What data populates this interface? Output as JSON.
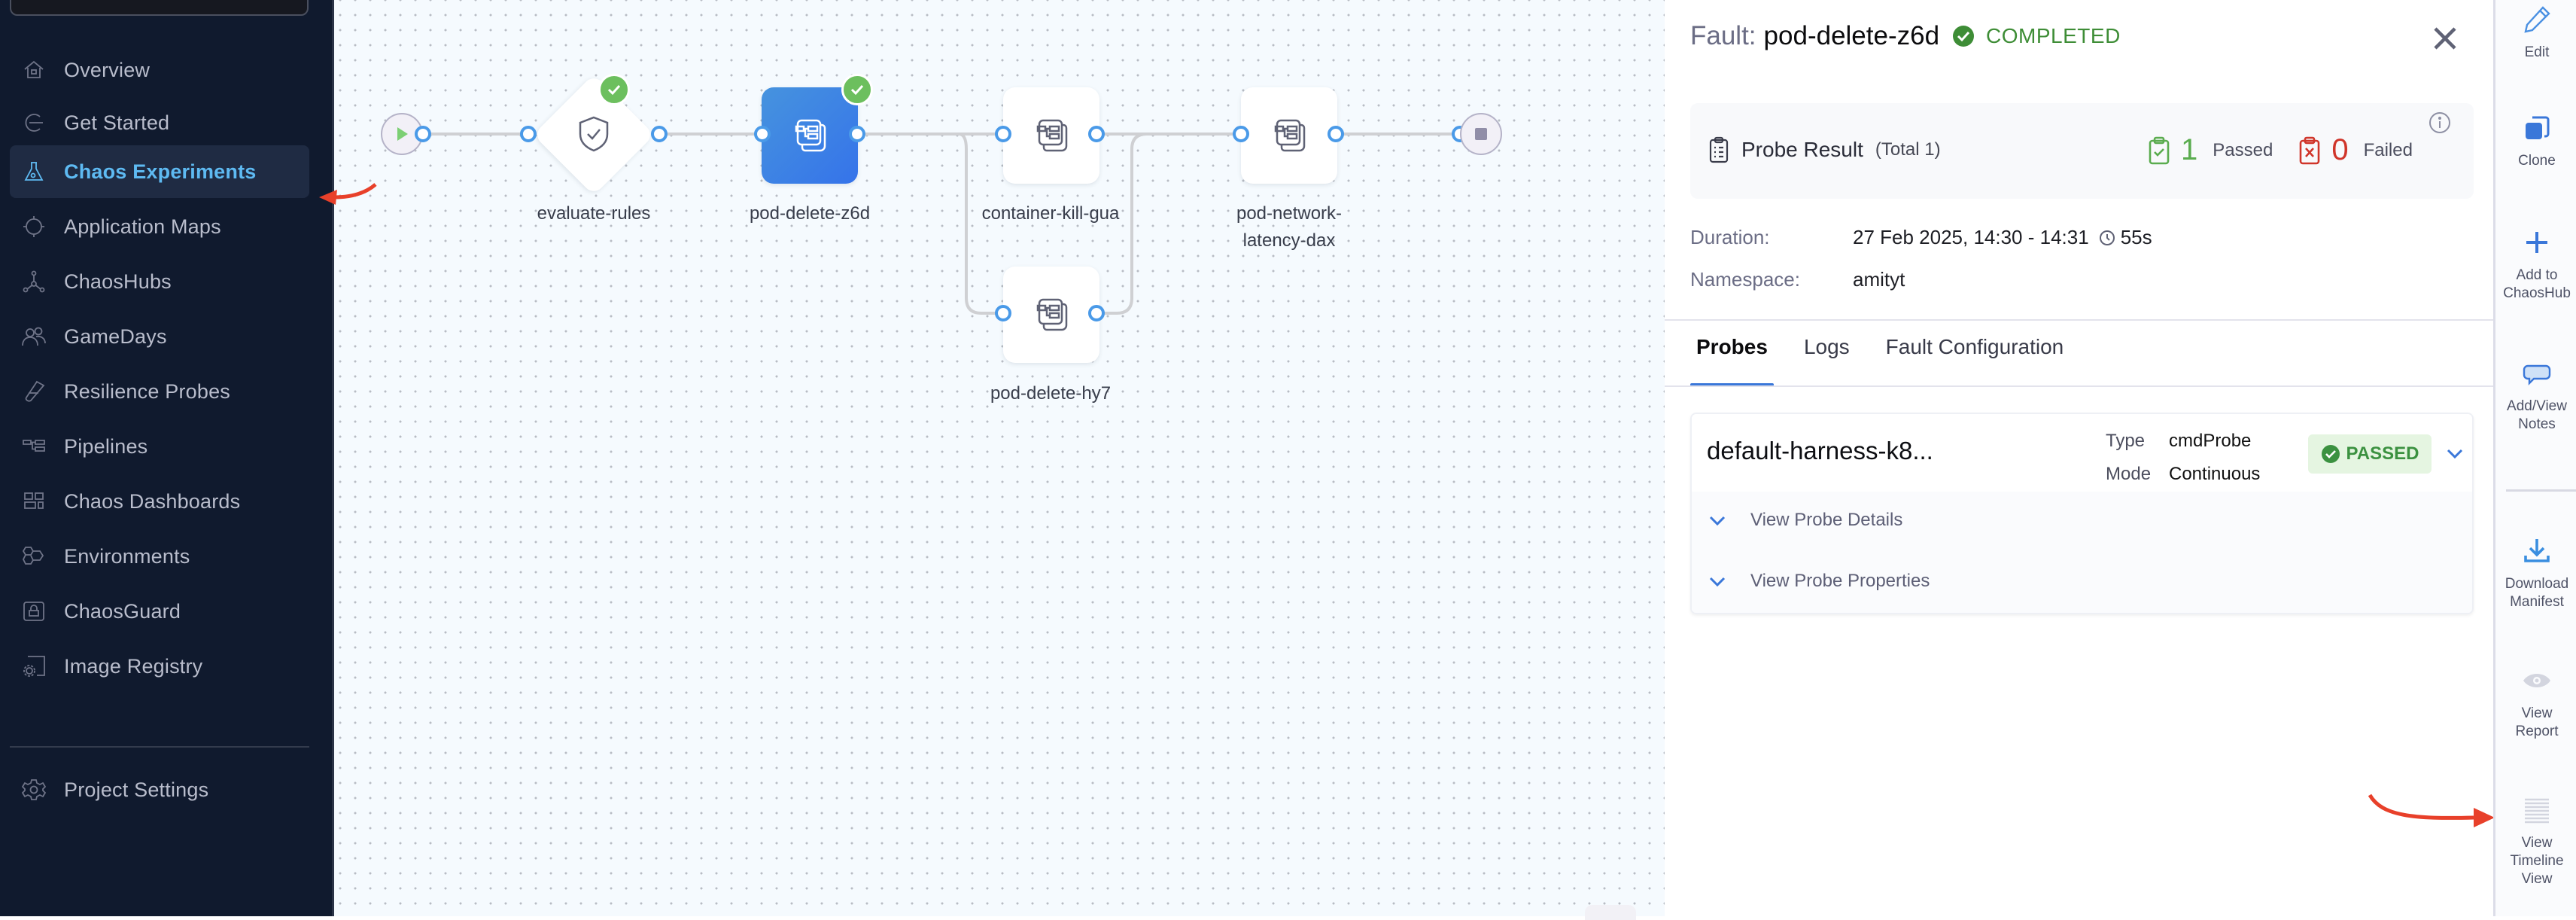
{
  "sidebar": {
    "items": [
      {
        "label": "Overview",
        "icon": "home-icon",
        "active": false
      },
      {
        "label": "Get Started",
        "icon": "get-started-icon",
        "active": false
      },
      {
        "label": "Chaos Experiments",
        "icon": "flask-icon",
        "active": true
      },
      {
        "label": "Application Maps",
        "icon": "target-icon",
        "active": false
      },
      {
        "label": "ChaosHubs",
        "icon": "hub-icon",
        "active": false
      },
      {
        "label": "GameDays",
        "icon": "users-icon",
        "active": false
      },
      {
        "label": "Resilience Probes",
        "icon": "probe-icon",
        "active": false
      },
      {
        "label": "Pipelines",
        "icon": "pipeline-icon",
        "active": false
      },
      {
        "label": "Chaos Dashboards",
        "icon": "dashboard-icon",
        "active": false
      },
      {
        "label": "Environments",
        "icon": "environments-icon",
        "active": false
      },
      {
        "label": "ChaosGuard",
        "icon": "lock-icon",
        "active": false
      },
      {
        "label": "Image Registry",
        "icon": "image-registry-icon",
        "active": false
      }
    ],
    "footer": {
      "label": "Project Settings",
      "icon": "gear-icon"
    }
  },
  "canvas": {
    "nodes": [
      {
        "id": "evaluate-rules",
        "label": "evaluate-rules",
        "kind": "condition",
        "status": "completed",
        "icon": "shield-check-icon"
      },
      {
        "id": "pod-delete-z6d",
        "label": "pod-delete-z6d",
        "kind": "fault",
        "status": "completed",
        "selected": true,
        "icon": "fault-icon"
      },
      {
        "id": "container-kill-gua",
        "label": "container-kill-gua",
        "kind": "fault",
        "icon": "fault-icon"
      },
      {
        "id": "pod-delete-hy7",
        "label": "pod-delete-hy7",
        "kind": "fault",
        "icon": "fault-icon"
      },
      {
        "id": "pod-network-latency-dax",
        "label": "pod-network-\nlatency-dax",
        "kind": "fault",
        "icon": "fault-icon"
      }
    ],
    "start_icon": "play-icon",
    "end_icon": "stop-icon"
  },
  "panel": {
    "title_prefix": "Fault:",
    "fault_name": "pod-delete-z6d",
    "status": "COMPLETED",
    "status_color": "#3e8d36",
    "probe_result": {
      "title": "Probe Result",
      "total": "(Total 1)",
      "passed_count": "1",
      "passed_label": "Passed",
      "failed_count": "0",
      "failed_label": "Failed",
      "passed_color": "#5aac4e",
      "failed_color": "#d0352a"
    },
    "duration_label": "Duration:",
    "duration_value": "27 Feb 2025, 14:30 - 14:31",
    "duration_elapsed": "55s",
    "namespace_label": "Namespace:",
    "namespace_value": "amityt",
    "tabs": [
      {
        "label": "Probes",
        "active": true
      },
      {
        "label": "Logs",
        "active": false
      },
      {
        "label": "Fault Configuration",
        "active": false
      }
    ],
    "probe": {
      "name": "default-harness-k8...",
      "type_label": "Type",
      "type_value": "cmdProbe",
      "mode_label": "Mode",
      "mode_value": "Continuous",
      "status": "PASSED",
      "details_label": "View Probe Details",
      "properties_label": "View Probe Properties"
    }
  },
  "toolbar": {
    "items": [
      {
        "label": "Edit",
        "icon": "pencil-icon"
      },
      {
        "label": "Clone",
        "icon": "clone-icon"
      },
      {
        "label": "Add to\nChaosHub",
        "icon": "plus-icon"
      },
      {
        "label": "Add/View\nNotes",
        "icon": "comment-icon"
      },
      {
        "label": "Download\nManifest",
        "icon": "download-icon"
      },
      {
        "label": "View\nReport",
        "icon": "eye-icon"
      },
      {
        "label": "View\nTimeline\nView",
        "icon": "timeline-icon"
      }
    ]
  },
  "colors": {
    "accent": "#3a77d9",
    "sidebar_bg": "#101a2e",
    "sidebar_active_text": "#5ebaf2",
    "annotation_arrow": "#e8402a"
  }
}
